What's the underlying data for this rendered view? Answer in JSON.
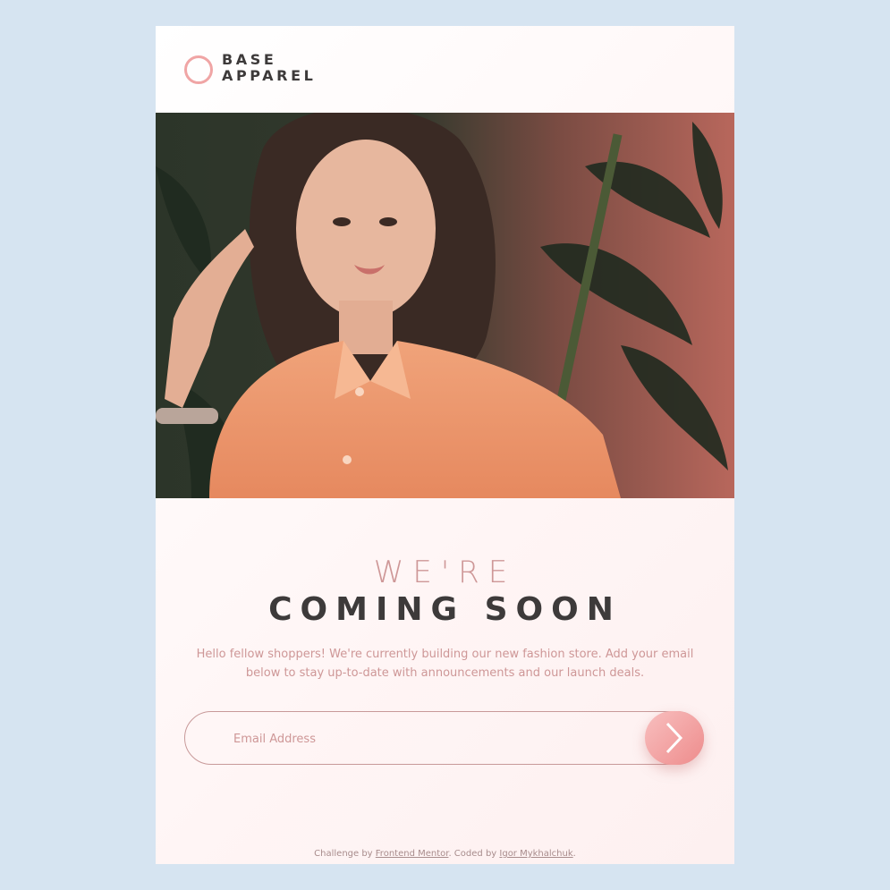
{
  "brand": {
    "line1": "BASE",
    "line2": "APPAREL",
    "accent_color": "#f0a5a5"
  },
  "hero": {
    "image": "woman-in-orange-shirt-photo"
  },
  "heading": {
    "light": "WE'RE",
    "bold": "COMING SOON"
  },
  "description": "Hello fellow shoppers! We're currently building our new fashion store. Add your email below to stay up-to-date with announcements and our launch deals.",
  "form": {
    "email_placeholder": "Email Address",
    "submit_icon": "chevron-right-icon"
  },
  "footer": {
    "prefix": "Challenge by ",
    "link1": "Frontend Mentor",
    "middle": ". Coded by ",
    "link2": "Igor Mykhalchuk",
    "suffix": "."
  },
  "colors": {
    "page_background": "#d6e4f1",
    "primary_text": "#3d3a3a",
    "desaturated_red": "#ce9797",
    "gradient_button_start": "#f8bfbf",
    "gradient_button_end": "#ee8c8c"
  }
}
